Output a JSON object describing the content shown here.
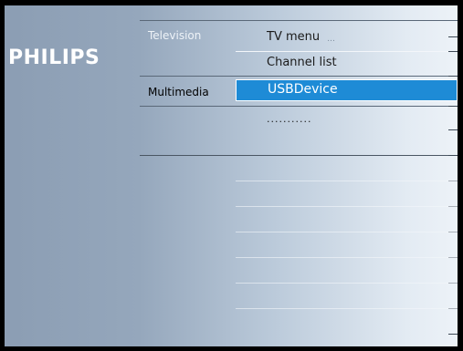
{
  "brand": {
    "logo_text": "PHILIPS"
  },
  "categories": [
    {
      "label": "Television",
      "active": false
    },
    {
      "label": "Multimedia",
      "active": true
    }
  ],
  "menu_items": [
    {
      "label": "TV menu",
      "hint": "..."
    },
    {
      "label": "Channel list"
    },
    {
      "label": "USBDevice",
      "selected": true
    },
    {
      "label": "..........."
    }
  ],
  "colors": {
    "selection": "#1e8bd6",
    "logo": "#ffffff"
  }
}
